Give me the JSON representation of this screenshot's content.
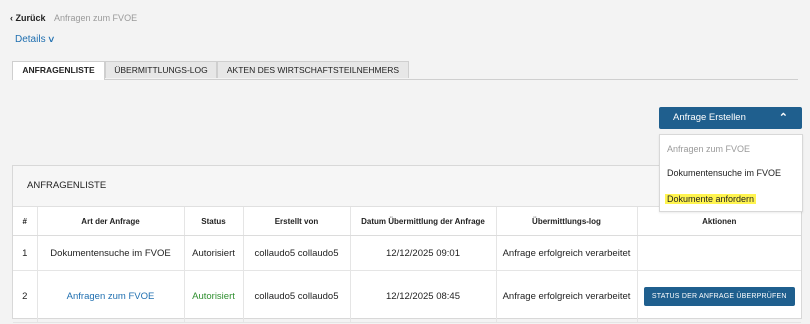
{
  "header": {
    "back_label": "‹ Zurück",
    "breadcrumb": "Anfragen zum FVOE"
  },
  "details": {
    "label": "Details",
    "icon": "chevron-down-icon"
  },
  "tabs": [
    {
      "label": "ANFRAGENLISTE",
      "active": true
    },
    {
      "label": "ÜBERMITTLUNGS-LOG",
      "active": false
    },
    {
      "label": "AKTEN DES WIRTSCHAFTSTEILNEHMERS",
      "active": false
    }
  ],
  "create_button": {
    "label": "Anfrage Erstellen",
    "icon": "chevron-up-icon"
  },
  "dropdown": {
    "items": [
      {
        "label": "Anfragen zum FVOE",
        "disabled": true
      },
      {
        "label": "Dokumentensuche im FVOE",
        "disabled": false
      },
      {
        "label": "Dokumente anfordern",
        "highlighted": true
      }
    ]
  },
  "panel": {
    "title": "ANFRAGENLISTE",
    "columns": [
      "#",
      "Art der Anfrage",
      "Status",
      "Erstellt von",
      "Datum Übermittlung der Anfrage",
      "Übermittlungs-log",
      "Aktionen"
    ],
    "rows": [
      {
        "num": "1",
        "type": "Dokumentensuche im FVOE",
        "status": "Autorisiert",
        "created_by": "collaudo5 collaudo5",
        "date": "12/12/2025 09:01",
        "log": "Anfrage erfolgreich verarbeitet",
        "action": ""
      },
      {
        "num": "2",
        "type": "Anfragen zum FVOE",
        "status": "Autorisiert",
        "created_by": "collaudo5 collaudo5",
        "date": "12/12/2025 08:45",
        "log": "Anfrage erfolgreich verarbeitet",
        "action": "STATUS DER ANFRAGE ÜBERPRÜFEN"
      }
    ]
  },
  "colors": {
    "primary": "#1f5f8e",
    "link": "#1f6fb0",
    "status_green": "#2f8f2f",
    "highlight": "#fff44f"
  }
}
